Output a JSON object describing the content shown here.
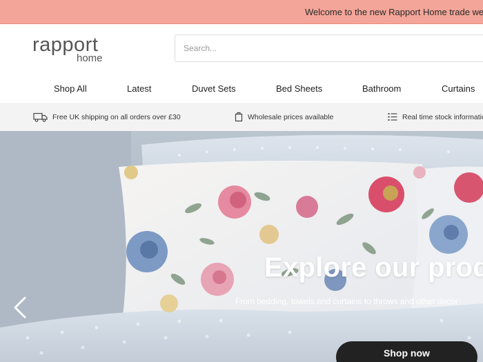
{
  "announcement": "Welcome to the new Rapport Home trade website",
  "header": {
    "logo_main": "rapport",
    "logo_sub": "home",
    "search_placeholder": "Search..."
  },
  "nav": [
    "Shop All",
    "Latest",
    "Duvet Sets",
    "Bed Sheets",
    "Bathroom",
    "Curtains"
  ],
  "features": [
    {
      "icon": "truck-icon",
      "text": "Free UK shipping on all orders over £30"
    },
    {
      "icon": "box-icon",
      "text": "Wholesale prices available"
    },
    {
      "icon": "list-icon",
      "text": "Real time stock information"
    }
  ],
  "hero": {
    "title": "Explore our products",
    "subtitle": "From bedding, towels and curtains to throws and other decor",
    "button": "Shop now"
  },
  "colors": {
    "announcement_bg": "#f2a598",
    "button_bg": "#222222",
    "feature_bar_bg": "#f3f3f3"
  }
}
